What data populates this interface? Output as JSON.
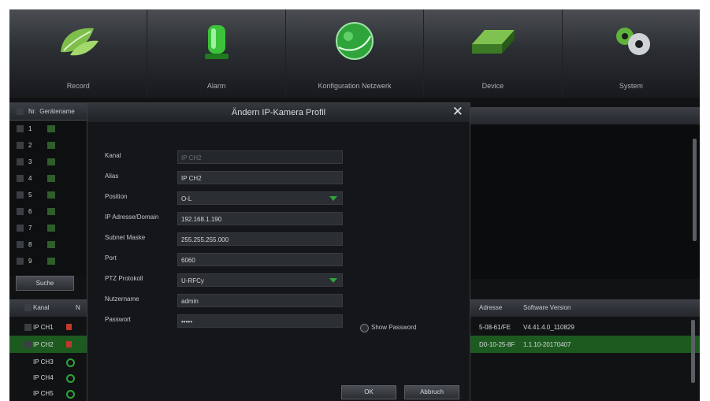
{
  "nav": [
    {
      "label": "Record",
      "icon": "leaf-icon"
    },
    {
      "label": "Alarm",
      "icon": "alarm-siren-icon"
    },
    {
      "label": "Konfiguration Netzwerk",
      "icon": "globe-network-icon"
    },
    {
      "label": "Device",
      "icon": "hard-drive-icon"
    },
    {
      "label": "System",
      "icon": "gears-icon"
    }
  ],
  "left_table": {
    "headers": [
      "Nr.",
      "Gerätename"
    ],
    "rows": [
      "1",
      "2",
      "3",
      "4",
      "5",
      "6",
      "7",
      "8",
      "9"
    ],
    "search_label": "Suche"
  },
  "dialog": {
    "title": "Ändern IP-Kamera Profil",
    "fields": {
      "kanal": {
        "label": "Kanal",
        "value": "IP CH2"
      },
      "alias": {
        "label": "Alias",
        "value": "IP CH2"
      },
      "position": {
        "label": "Position",
        "value": "O-L"
      },
      "ip": {
        "label": "IP Adresse/Domain",
        "value": "192.168.1.190"
      },
      "subnet": {
        "label": "Subnet Maske",
        "value": "255.255.255.000"
      },
      "port": {
        "label": "Port",
        "value": "6060"
      },
      "ptz": {
        "label": "PTZ Protokoll",
        "value": "U-RFCy"
      },
      "user": {
        "label": "Nutzername",
        "value": "admin"
      },
      "password": {
        "label": "Passwort",
        "value": "•••••"
      }
    },
    "show_password_label": "Show Password",
    "ok_label": "OK",
    "cancel_label": "Abbruch"
  },
  "bottom_table": {
    "headers": {
      "kanal": "Kanal",
      "n": "N",
      "adresse": "Adresse",
      "software": "Software Version"
    },
    "rows": [
      {
        "name": "IP CH1",
        "status": "red",
        "adresse": "5-08-61/FE",
        "software": "V4.41.4.0_110829",
        "selected": false
      },
      {
        "name": "IP CH2",
        "status": "red",
        "adresse": "D0-10-25-8F",
        "software": "1.1.10-20170407",
        "selected": true
      },
      {
        "name": "IP CH3",
        "status": "green",
        "adresse": "",
        "software": "",
        "selected": false
      },
      {
        "name": "IP CH4",
        "status": "green",
        "adresse": "",
        "software": "",
        "selected": false
      },
      {
        "name": "IP CH5",
        "status": "green",
        "adresse": "",
        "software": "",
        "selected": false
      }
    ]
  },
  "colors": {
    "accent_green": "#2fa43a",
    "selected_row": "#1d5a20",
    "status_red": "#c0392b"
  }
}
